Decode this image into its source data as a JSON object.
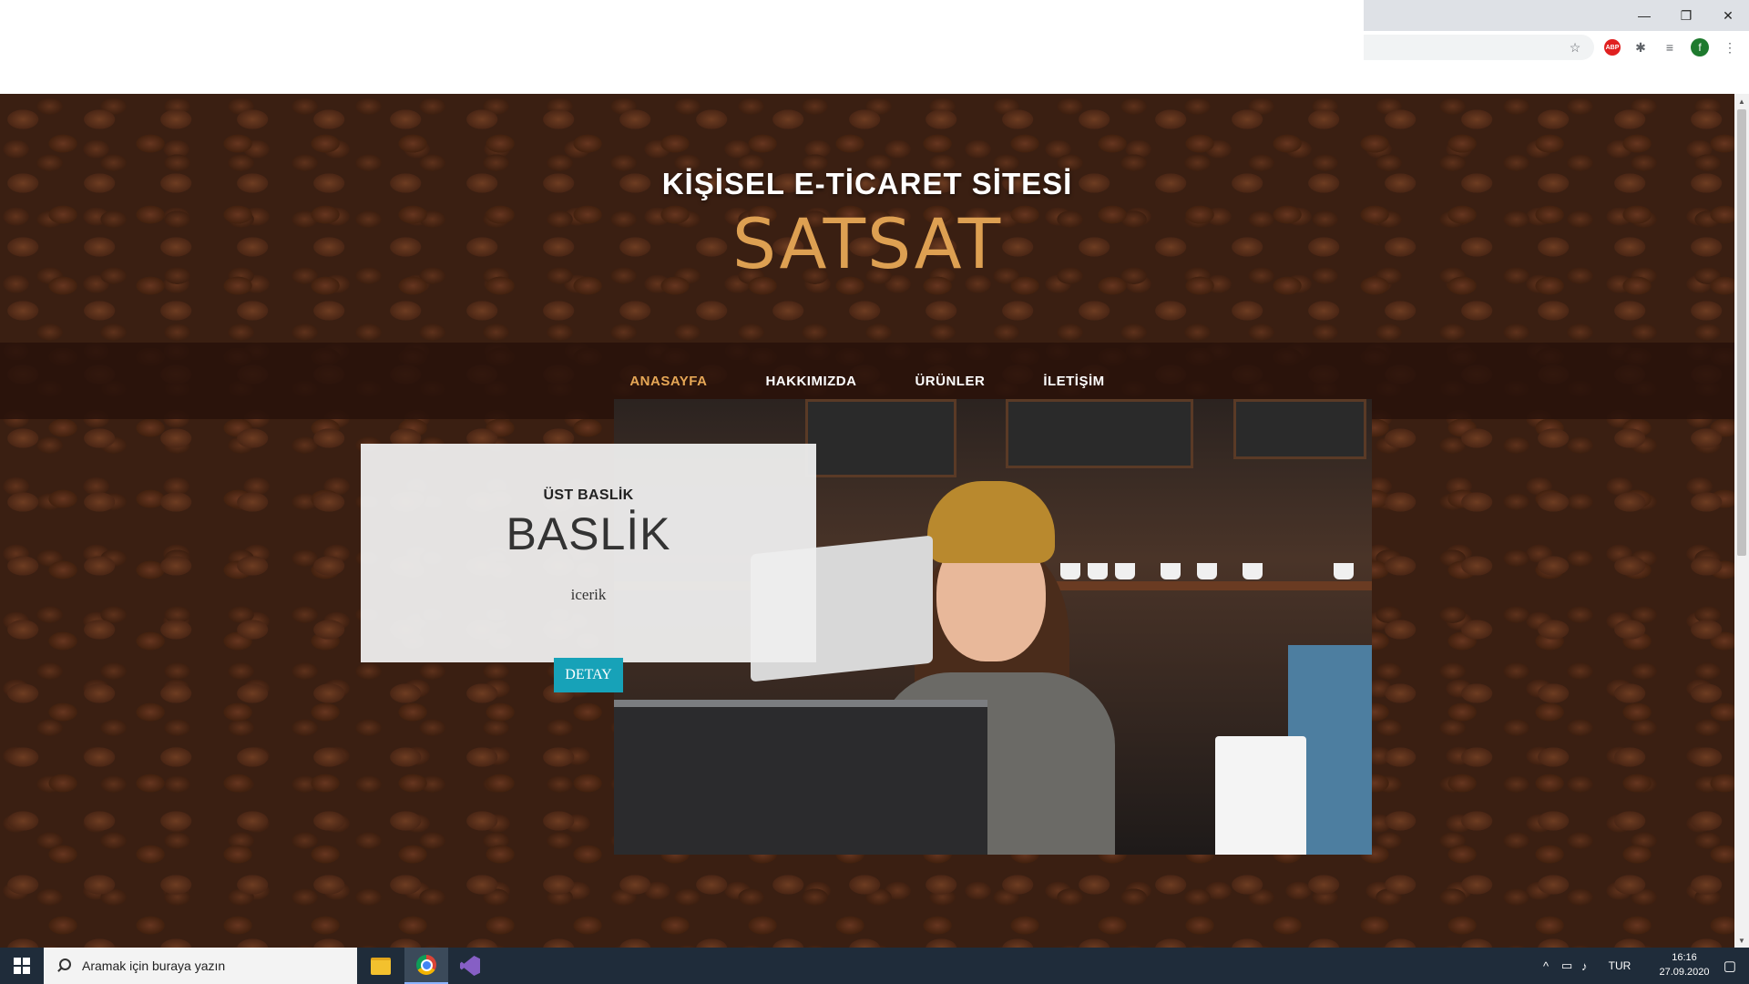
{
  "browser": {
    "window_controls": {
      "minimize": "—",
      "restore": "❐",
      "close": "✕"
    },
    "extensions": {
      "abp_label": "ABP",
      "profile_initial": "f"
    }
  },
  "site": {
    "heading_upper": "KİŞİSEL E-TİCARET SİTESİ",
    "heading_lower": "SATSAT",
    "accent_color": "#e6a756",
    "nav": [
      {
        "label": "ANASAYFA",
        "active": true
      },
      {
        "label": "HAKKIMIZDA",
        "active": false
      },
      {
        "label": "ÜRÜNLER",
        "active": false
      },
      {
        "label": "İLETİŞİM",
        "active": false
      }
    ],
    "card": {
      "upper": "ÜST BASLİK",
      "title": "BASLİK",
      "text": "icerik",
      "button_label": "DETAY",
      "button_color": "#17a2b8"
    }
  },
  "taskbar": {
    "search_placeholder": "Aramak için buraya yazın",
    "apps": [
      "file-explorer",
      "chrome",
      "visual-studio"
    ],
    "language": "TUR",
    "time": "16:16",
    "date": "27.09.2020"
  }
}
